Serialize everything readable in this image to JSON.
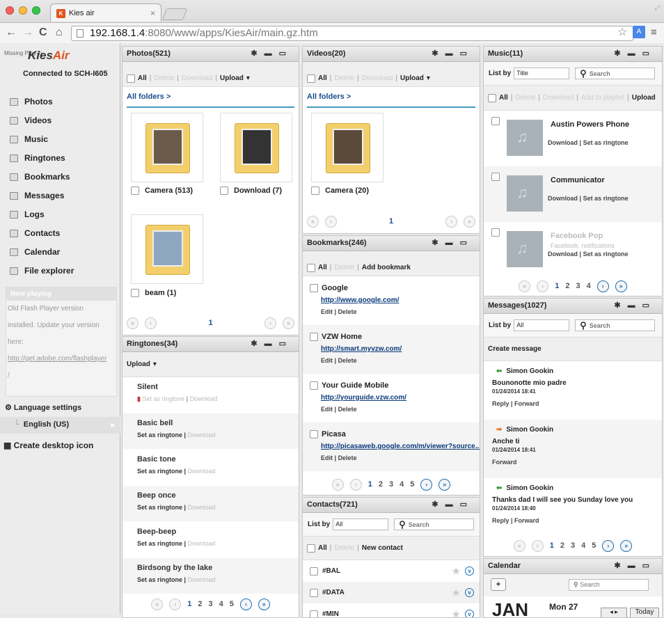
{
  "browser": {
    "tab_title": "Kies air",
    "url_host": "192.168.1.4",
    "url_path": ":8080/www/apps/KiesAir/main.gz.htm"
  },
  "sidebar": {
    "missing_text": "Missing Plug-in",
    "logo_kies": "Kies",
    "logo_air": "Air",
    "connected": "Connected to SCH-I605",
    "items": [
      {
        "label": "Photos",
        "icon": "photo-icon"
      },
      {
        "label": "Videos",
        "icon": "video-icon"
      },
      {
        "label": "Music",
        "icon": "music-icon"
      },
      {
        "label": "Ringtones",
        "icon": "ringtone-icon"
      },
      {
        "label": "Bookmarks",
        "icon": "bookmark-icon"
      },
      {
        "label": "Messages",
        "icon": "message-icon"
      },
      {
        "label": "Logs",
        "icon": "log-icon"
      },
      {
        "label": "Contacts",
        "icon": "contact-icon"
      },
      {
        "label": "Calendar",
        "icon": "calendar-icon"
      },
      {
        "label": "File explorer",
        "icon": "folder-icon"
      }
    ],
    "now_playing": {
      "header": "Now playing",
      "lines": [
        "Old Flash Player version",
        "installed. Update your version",
        "here:"
      ],
      "link": "http://get.adobe.com/flashplayer",
      "tail": "/"
    },
    "language_settings": "Language settings",
    "language_value": "English (US)",
    "desktop_icon": "Create desktop icon"
  },
  "common": {
    "all": "All",
    "delete": "Delete",
    "download": "Download",
    "upload": "Upload",
    "sep": "|",
    "list_by": "List by",
    "search": "Search",
    "all_folders": "All folders >",
    "set_ringtone": "Set as ringtone",
    "edit": "Edit",
    "reply": "Reply",
    "forward": "Forward"
  },
  "photos": {
    "title": "Photos(521)",
    "folders": [
      {
        "label": "Camera (513)"
      },
      {
        "label": "Download (7)"
      },
      {
        "label": "beam (1)"
      }
    ],
    "page": "1"
  },
  "videos": {
    "title": "Videos(20)",
    "folders": [
      {
        "label": "Camera (20)"
      }
    ],
    "page": "1"
  },
  "ringtones": {
    "title": "Ringtones(34)",
    "upload": "Upload",
    "items": [
      "Silent",
      "Basic bell",
      "Basic tone",
      "Beep once",
      "Beep-beep",
      "Birdsong by the lake"
    ],
    "pages": [
      "1",
      "2",
      "3",
      "4",
      "5"
    ]
  },
  "bookmarks": {
    "title": "Bookmarks(246)",
    "add": "Add bookmark",
    "items": [
      {
        "title": "Google",
        "url": "http://www.google.com/"
      },
      {
        "title": "VZW Home",
        "url": "http://smart.myvzw.com/"
      },
      {
        "title": "Your Guide Mobile",
        "url": "http://yourguide.vzw.com/"
      },
      {
        "title": "Picasa",
        "url": "http://picasaweb.google.com/m/viewer?source..."
      }
    ],
    "pages": [
      "1",
      "2",
      "3",
      "4",
      "5"
    ]
  },
  "contacts": {
    "title": "Contacts(721)",
    "list_value": "All",
    "new": "New contact",
    "items": [
      "#BAL",
      "#DATA",
      "#MIN"
    ]
  },
  "music": {
    "title": "Music(11)",
    "list_value": "Title",
    "add_playlist": "Add to playlist",
    "items": [
      {
        "title": "Austin Powers Phone",
        "sub": ""
      },
      {
        "title": "Communicator",
        "sub": ""
      },
      {
        "title": "Facebook Pop",
        "sub": "Facebook, notifications"
      }
    ],
    "pages": [
      "1",
      "2",
      "3",
      "4"
    ]
  },
  "messages": {
    "title": "Messages(1027)",
    "list_value": "All",
    "create": "Create message",
    "items": [
      {
        "from": "Simon Gookin",
        "body": "Bounonotte mio padre",
        "date": "01/24/2014 18:41",
        "actions": "Reply | Forward",
        "dir": "in"
      },
      {
        "from": "Simon Gookin",
        "body": "Anche ti",
        "date": "01/24/2014 18:41",
        "actions": "Forward",
        "dir": "out"
      },
      {
        "from": "Simon Gookin",
        "body": "Thanks dad I will see you Sunday love you",
        "date": "01/24/2014 18:40",
        "actions": "Reply | Forward",
        "dir": "in"
      }
    ],
    "pages": [
      "1",
      "2",
      "3",
      "4",
      "5"
    ]
  },
  "calendar": {
    "title": "Calendar",
    "add": "+",
    "month": "JAN",
    "day": "Mon 27",
    "today": "Today"
  }
}
